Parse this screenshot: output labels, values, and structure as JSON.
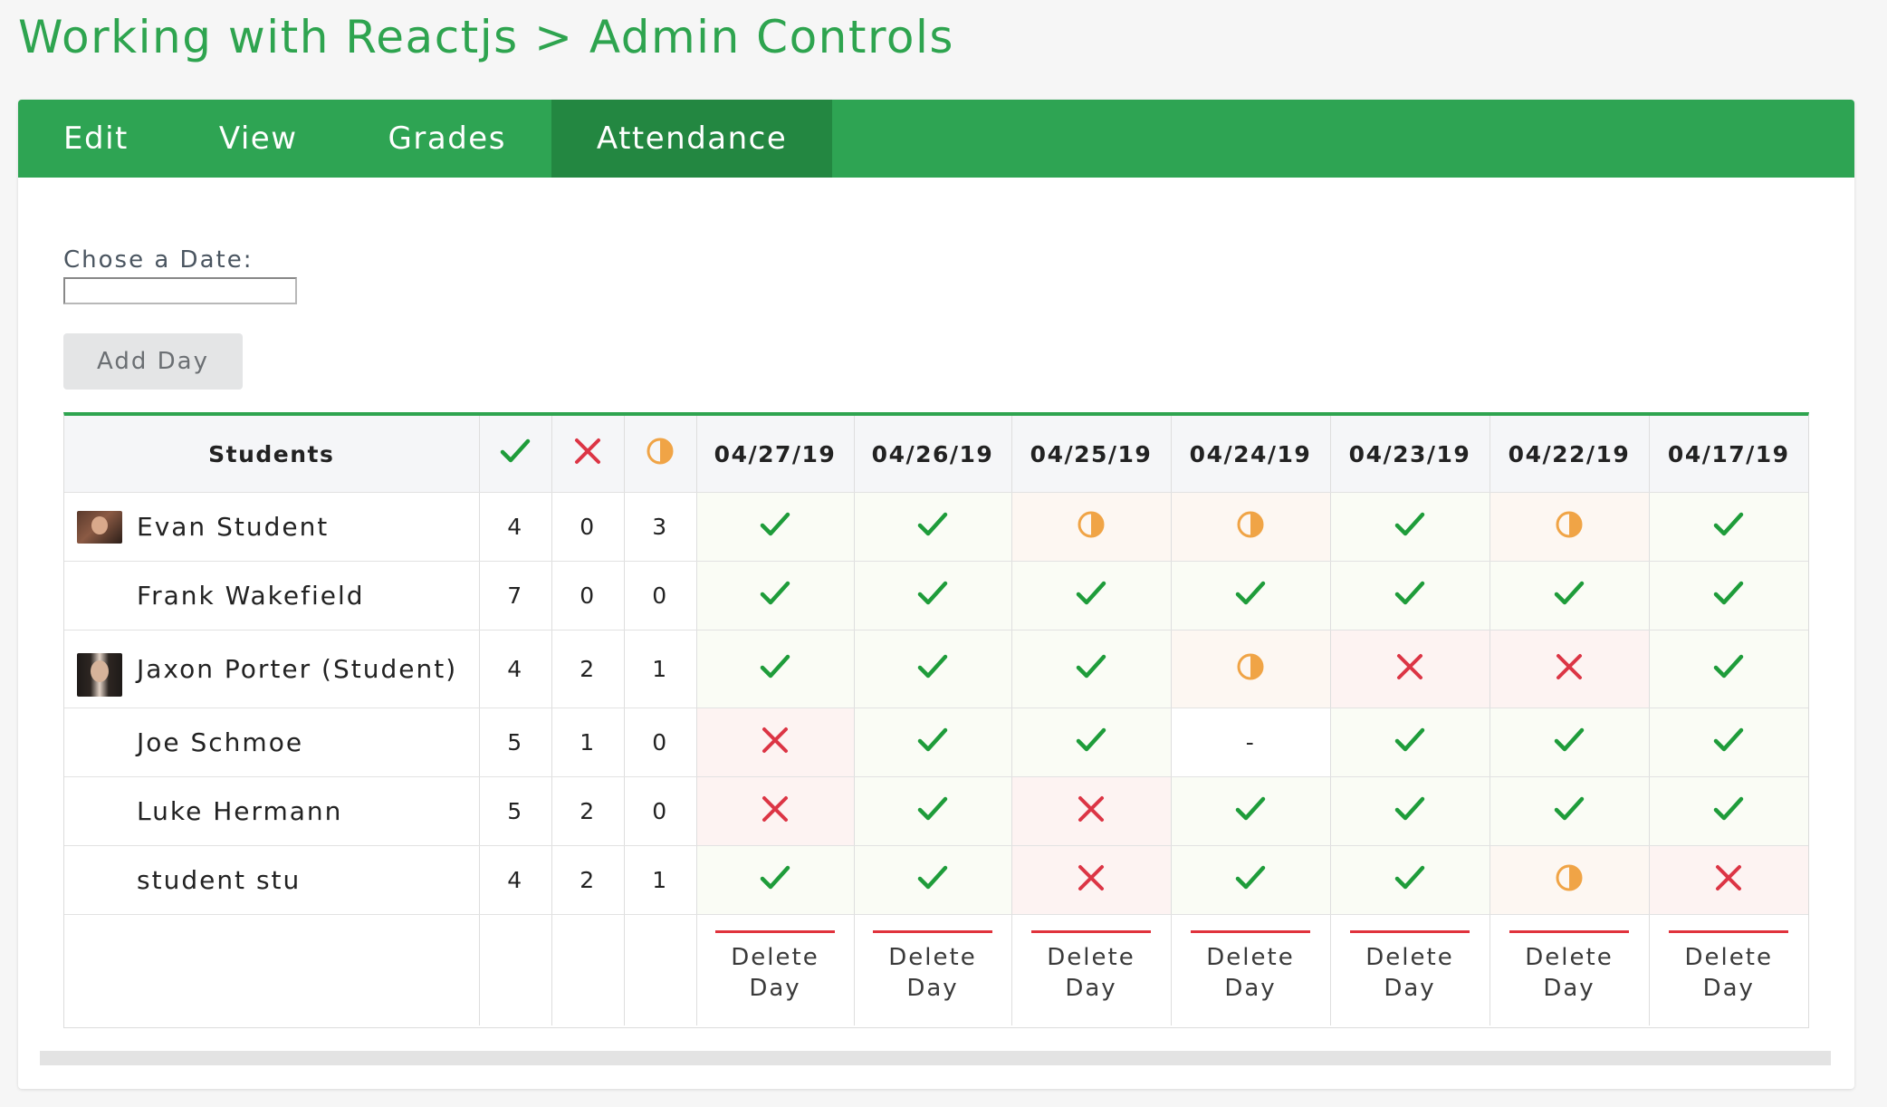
{
  "title": "Working with Reactjs > Admin Controls",
  "tabs": [
    {
      "label": "Edit",
      "active": false
    },
    {
      "label": "View",
      "active": false
    },
    {
      "label": "Grades",
      "active": false
    },
    {
      "label": "Attendance",
      "active": true
    }
  ],
  "date_picker": {
    "label": "Chose a Date:",
    "value": ""
  },
  "add_day_button": "Add Day",
  "colors": {
    "accent": "#2ea44f",
    "present": "#1e9c3a",
    "absent": "#dc3545",
    "late": "#f0a446"
  },
  "table": {
    "students_header": "Students",
    "summary_icons": [
      "check-icon",
      "x-icon",
      "half-circle-icon"
    ],
    "dates": [
      "04/27/19",
      "04/26/19",
      "04/25/19",
      "04/24/19",
      "04/23/19",
      "04/22/19",
      "04/17/19"
    ],
    "rows": [
      {
        "name": "Evan Student",
        "avatar": true,
        "present": "4",
        "absent": "0",
        "late": "3",
        "statuses": [
          "present",
          "present",
          "late",
          "late",
          "present",
          "late",
          "present"
        ]
      },
      {
        "name": "Frank Wakefield",
        "avatar": false,
        "present": "7",
        "absent": "0",
        "late": "0",
        "statuses": [
          "present",
          "present",
          "present",
          "present",
          "present",
          "present",
          "present"
        ]
      },
      {
        "name": "Jaxon Porter (Student)",
        "avatar": true,
        "present": "4",
        "absent": "2",
        "late": "1",
        "statuses": [
          "present",
          "present",
          "present",
          "late",
          "absent",
          "absent",
          "present"
        ]
      },
      {
        "name": "Joe Schmoe",
        "avatar": false,
        "present": "5",
        "absent": "1",
        "late": "0",
        "statuses": [
          "absent",
          "present",
          "present",
          "none",
          "present",
          "present",
          "present"
        ]
      },
      {
        "name": "Luke Hermann",
        "avatar": false,
        "present": "5",
        "absent": "2",
        "late": "0",
        "statuses": [
          "absent",
          "present",
          "absent",
          "present",
          "present",
          "present",
          "present"
        ]
      },
      {
        "name": "student stu",
        "avatar": false,
        "present": "4",
        "absent": "2",
        "late": "1",
        "statuses": [
          "present",
          "present",
          "absent",
          "present",
          "present",
          "late",
          "absent"
        ]
      }
    ],
    "empty_mark": "-",
    "delete_day_label": "Delete Day"
  }
}
